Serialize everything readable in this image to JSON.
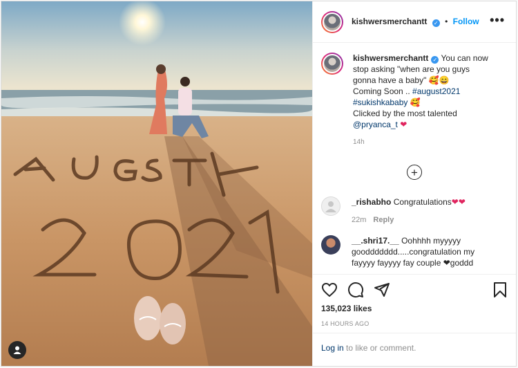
{
  "post": {
    "username": "kishwersmerchantt",
    "follow_label": "Follow",
    "dot": "•",
    "more": "•••",
    "caption_text": "You can now stop asking \"when are you guys gonna have a baby\" 🥰😄",
    "caption_line2": "Coming Soon .. ",
    "hashtag1": "#august2021",
    "hashtag2": "#sukishkababy",
    "emoji_after_tag": "🥰",
    "caption_line4": "Clicked by the most talented",
    "mention": "@pryanca_t",
    "heart": "❤",
    "time_ago": "14h",
    "load_more": "+"
  },
  "comments": [
    {
      "user": "_rishabho",
      "text": "Congratulations",
      "hearts": "❤❤",
      "time": "22m",
      "reply": "Reply"
    },
    {
      "user": "__.shri17.__",
      "text": "Oohhhh myyyyy gooddddddd.....congratulation my fayyyy fayyyy fay couple ❤goddd"
    }
  ],
  "actions": {
    "likes": "135,023 likes",
    "date": "14 HOURS AGO",
    "login_link": "Log in",
    "login_rest": " to like or comment."
  },
  "colors": {
    "accent": "#0095f6",
    "verified": "#3897f0",
    "heart": "#e0245e"
  }
}
